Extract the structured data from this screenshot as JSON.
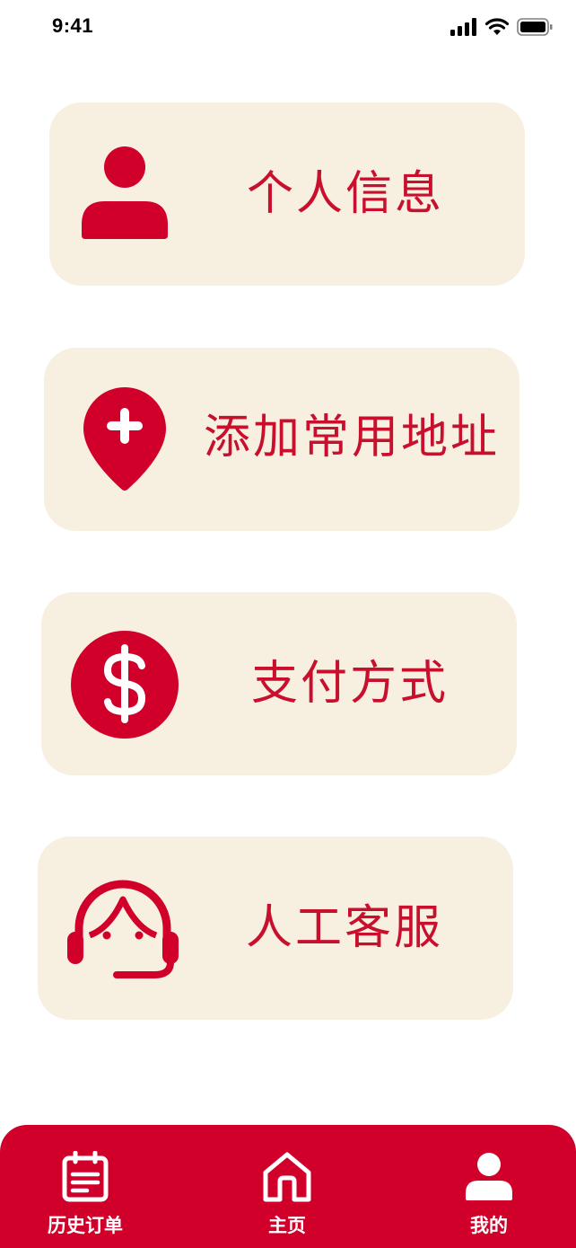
{
  "status_bar": {
    "time": "9:41",
    "icons": [
      "signal-icon",
      "wifi-icon",
      "battery-icon"
    ]
  },
  "menu": {
    "items": [
      {
        "label": "个人信息",
        "icon": "person-icon"
      },
      {
        "label": "添加常用地址",
        "icon": "location-plus-icon"
      },
      {
        "label": "支付方式",
        "icon": "dollar-circle-icon"
      },
      {
        "label": "人工客服",
        "icon": "headset-agent-icon"
      }
    ]
  },
  "tab_bar": {
    "items": [
      {
        "label": "历史订单",
        "icon": "order-history-icon"
      },
      {
        "label": "主页",
        "icon": "home-icon"
      },
      {
        "label": "我的",
        "icon": "person-icon"
      }
    ]
  },
  "colors": {
    "accent": "#c8102e",
    "tab_bar_background": "#d0002a",
    "card_background": "#f7efdf",
    "page_background": "#ffffff"
  }
}
